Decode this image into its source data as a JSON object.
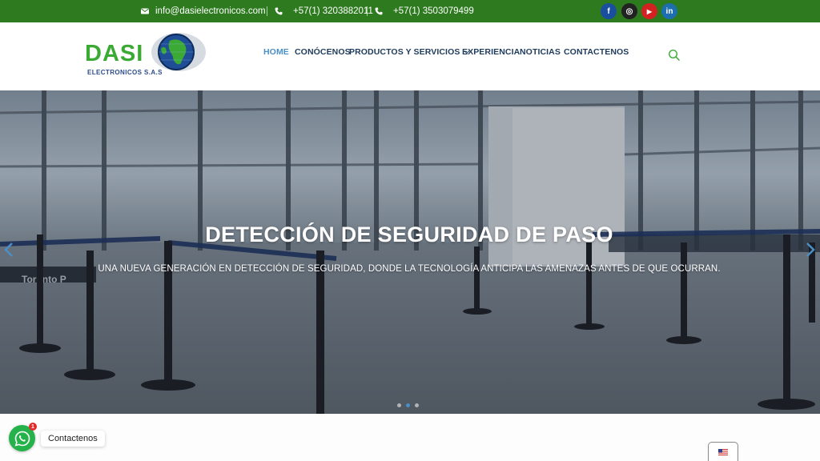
{
  "topbar": {
    "email": "info@dasielectronicos.com",
    "phone1": "+57(1) 3203882011",
    "phone2": "+57(1) 3503079499",
    "separator": "|",
    "social": [
      {
        "icon": "facebook-icon",
        "glyph": "f",
        "color": "#1a4fa0"
      },
      {
        "icon": "instagram-icon",
        "glyph": "◎",
        "color": "#222222"
      },
      {
        "icon": "youtube-icon",
        "glyph": "▶",
        "color": "#d42222"
      },
      {
        "icon": "linkedin-icon",
        "glyph": "in",
        "color": "#1d6fb0"
      }
    ],
    "color": "#2d7a1f"
  },
  "logo": {
    "name": "DASI",
    "subtitle": "ELECTRONICOS S.A.S"
  },
  "nav": {
    "home": "HOME",
    "about": "CONÓCENOS",
    "products": "PRODUCTOS Y SERVICIOS",
    "experience": "EXPERIENCIA",
    "news": "NOTICIAS",
    "contact": "CONTACTENOS",
    "active_color": "#4a8fc6"
  },
  "hero": {
    "title": "DETECCIÓN DE SEGURIDAD DE PASO",
    "subtitle": "UNA NUEVA GENERACIÓN EN DETECCIÓN DE SEGURIDAD, DONDE LA TECNOLOGÍA ANTICIPA LAS AMENAZAS ANTES DE QUE OCURRAN.",
    "sign_text": "Toronto P",
    "slides": 3,
    "active_slide": 2
  },
  "whatsapp": {
    "label": "Contactenos",
    "badge": "1",
    "color": "#25b24a"
  },
  "language": {
    "flag": "us-flag-icon"
  }
}
